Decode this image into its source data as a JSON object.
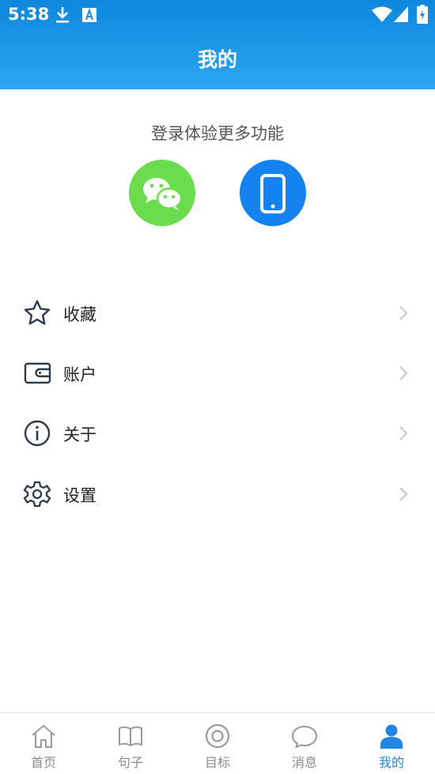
{
  "status_bar": {
    "time": "5:38",
    "left_icons": [
      "download-icon",
      "font-a-icon"
    ],
    "right_icons": [
      "wifi-icon",
      "signal-icon",
      "battery-icon"
    ]
  },
  "header": {
    "title": "我的",
    "color_start": "#0f87dc",
    "color_end": "#2aa6f4"
  },
  "login": {
    "prompt": "登录体验更多功能",
    "buttons": [
      {
        "icon": "wechat-icon",
        "color": "#6bdc4c"
      },
      {
        "icon": "phone-icon",
        "color": "#1483f0"
      }
    ]
  },
  "menu": {
    "items": [
      {
        "label": "收藏",
        "icon": "star-icon"
      },
      {
        "label": "账户",
        "icon": "wallet-icon"
      },
      {
        "label": "关于",
        "icon": "info-icon"
      },
      {
        "label": "设置",
        "icon": "gear-icon"
      }
    ]
  },
  "tabbar": {
    "active_color": "#1f86e6",
    "tabs": [
      {
        "label": "首页",
        "icon": "home-icon",
        "active": false
      },
      {
        "label": "句子",
        "icon": "book-icon",
        "active": false
      },
      {
        "label": "目标",
        "icon": "target-icon",
        "active": false
      },
      {
        "label": "消息",
        "icon": "chat-bubble-icon",
        "active": false
      },
      {
        "label": "我的",
        "icon": "person-icon",
        "active": true
      }
    ]
  }
}
